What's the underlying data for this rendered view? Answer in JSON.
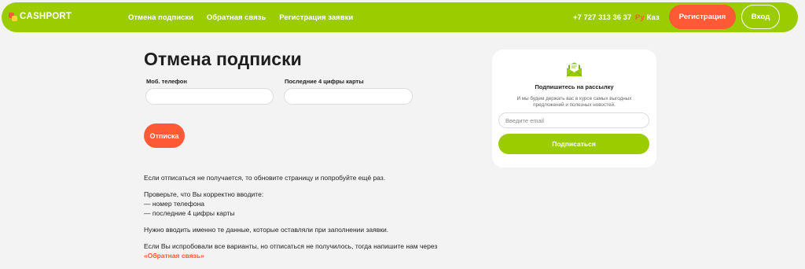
{
  "header": {
    "logo_text": "CASHPORT",
    "nav": [
      "Отмена подписки",
      "Обратная связь",
      "Регистрация заявки"
    ],
    "phone": "+7 727 313 36 37",
    "lang_ru": "Ру",
    "lang_kz": "Каз",
    "register_label": "Регистрация",
    "login_label": "Вход"
  },
  "colors": {
    "brand_green": "#9acc00",
    "accent_orange": "#ff5a36"
  },
  "main": {
    "title": "Отмена подписки",
    "phone_label": "Моб. телефон",
    "card_label": "Последние 4 цифры карты",
    "phone_value": "",
    "card_value": "",
    "unsubscribe_label": "Отписка",
    "info": {
      "p1": "Если отписаться не получается, то обновите страницу и попробуйте ещё раз.",
      "p2_line1": "Проверьте, что Вы корректно вводите:",
      "p2_line2": "— номер телефона",
      "p2_line3": "— последние 4 цифры карты",
      "p3": "Нужно вводить именно те данные, которые оставляли при заполнении заявки.",
      "p4_text": "Если Вы испробовали все варианты, но отписаться не получилось, тогда напишите нам через",
      "p4_link": "«Обратная связь»"
    }
  },
  "newsletter": {
    "icon": "mail-icon",
    "title": "Подпишитесь на рассылку",
    "description": "И мы будем держать вас в курсе самых выгодных предложений и полезных новостей.",
    "email_placeholder": "Введите email",
    "email_value": "",
    "subscribe_label": "Подписаться"
  }
}
